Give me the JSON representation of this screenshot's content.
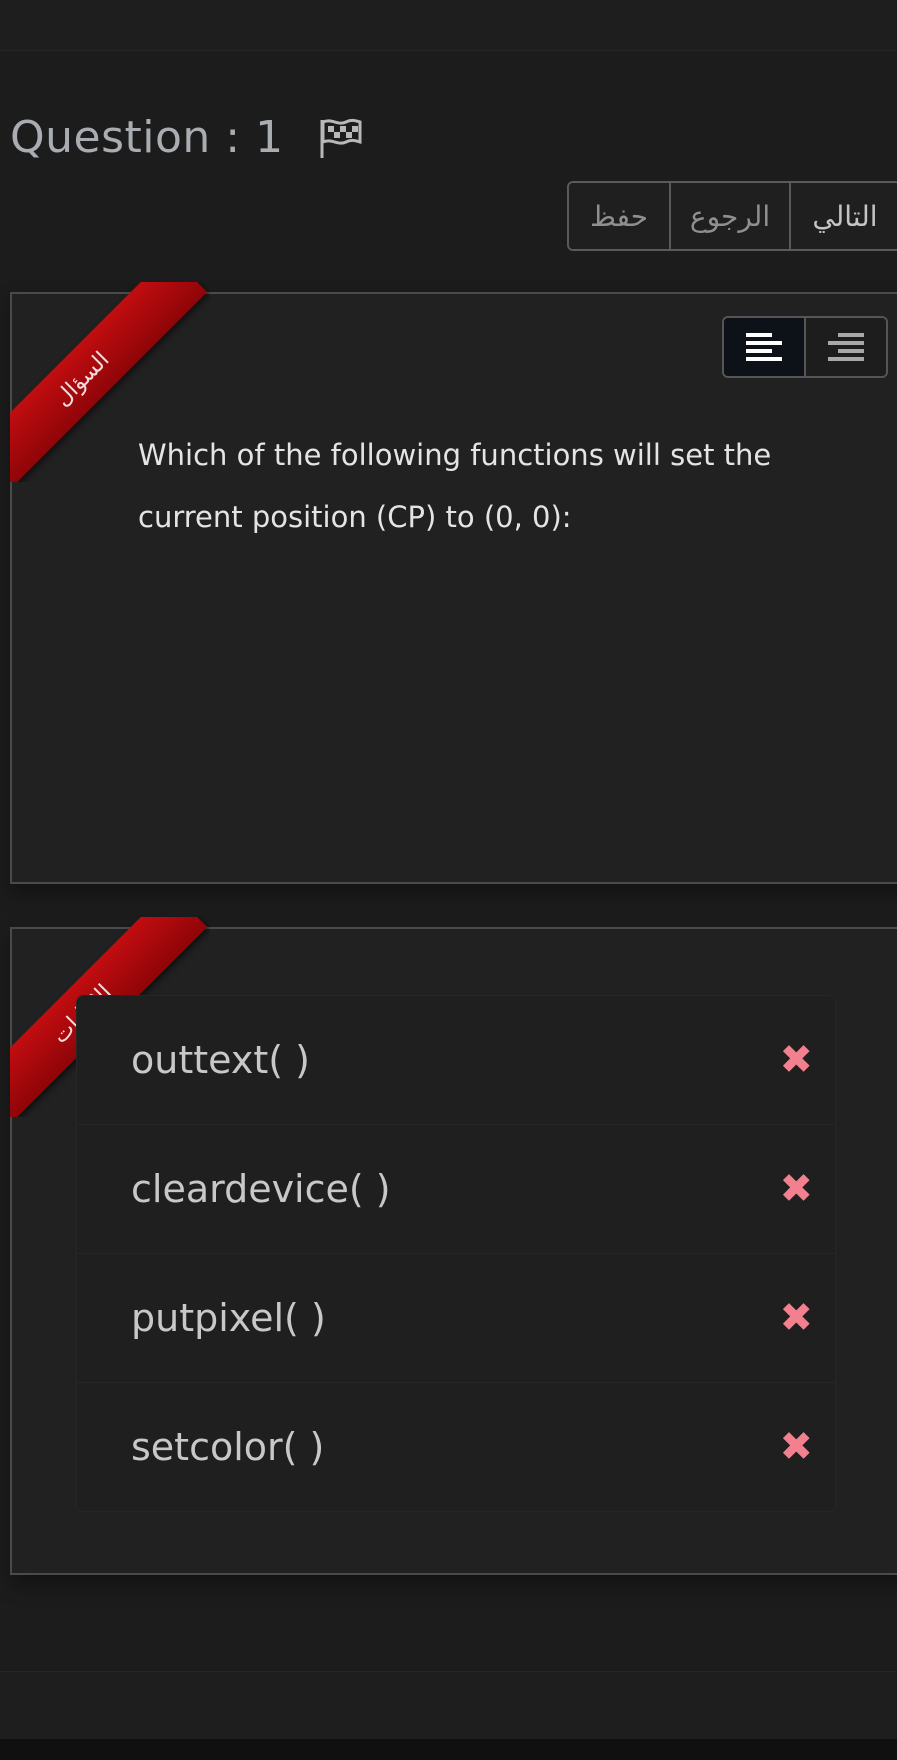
{
  "header": {
    "question_title": "Question : 1"
  },
  "nav": {
    "next_label": "التالي",
    "back_label": "الرجوع",
    "save_label": "حفظ"
  },
  "question": {
    "ribbon_label": "السؤال",
    "text": "Which of the following functions will set the current position (CP)  to (0, 0):"
  },
  "answers": {
    "ribbon_label": "الاجابات",
    "options": [
      {
        "label": "outtext( )",
        "status_icon": "x-icon"
      },
      {
        "label": "cleardevice( )",
        "status_icon": "x-icon"
      },
      {
        "label": "putpixel( )",
        "status_icon": "x-icon"
      },
      {
        "label": "setcolor( )",
        "status_icon": "x-icon"
      }
    ]
  },
  "colors": {
    "ribbon": "#b00b0e",
    "wrong_mark": "#f2808e",
    "background": "#1c1c1c"
  }
}
